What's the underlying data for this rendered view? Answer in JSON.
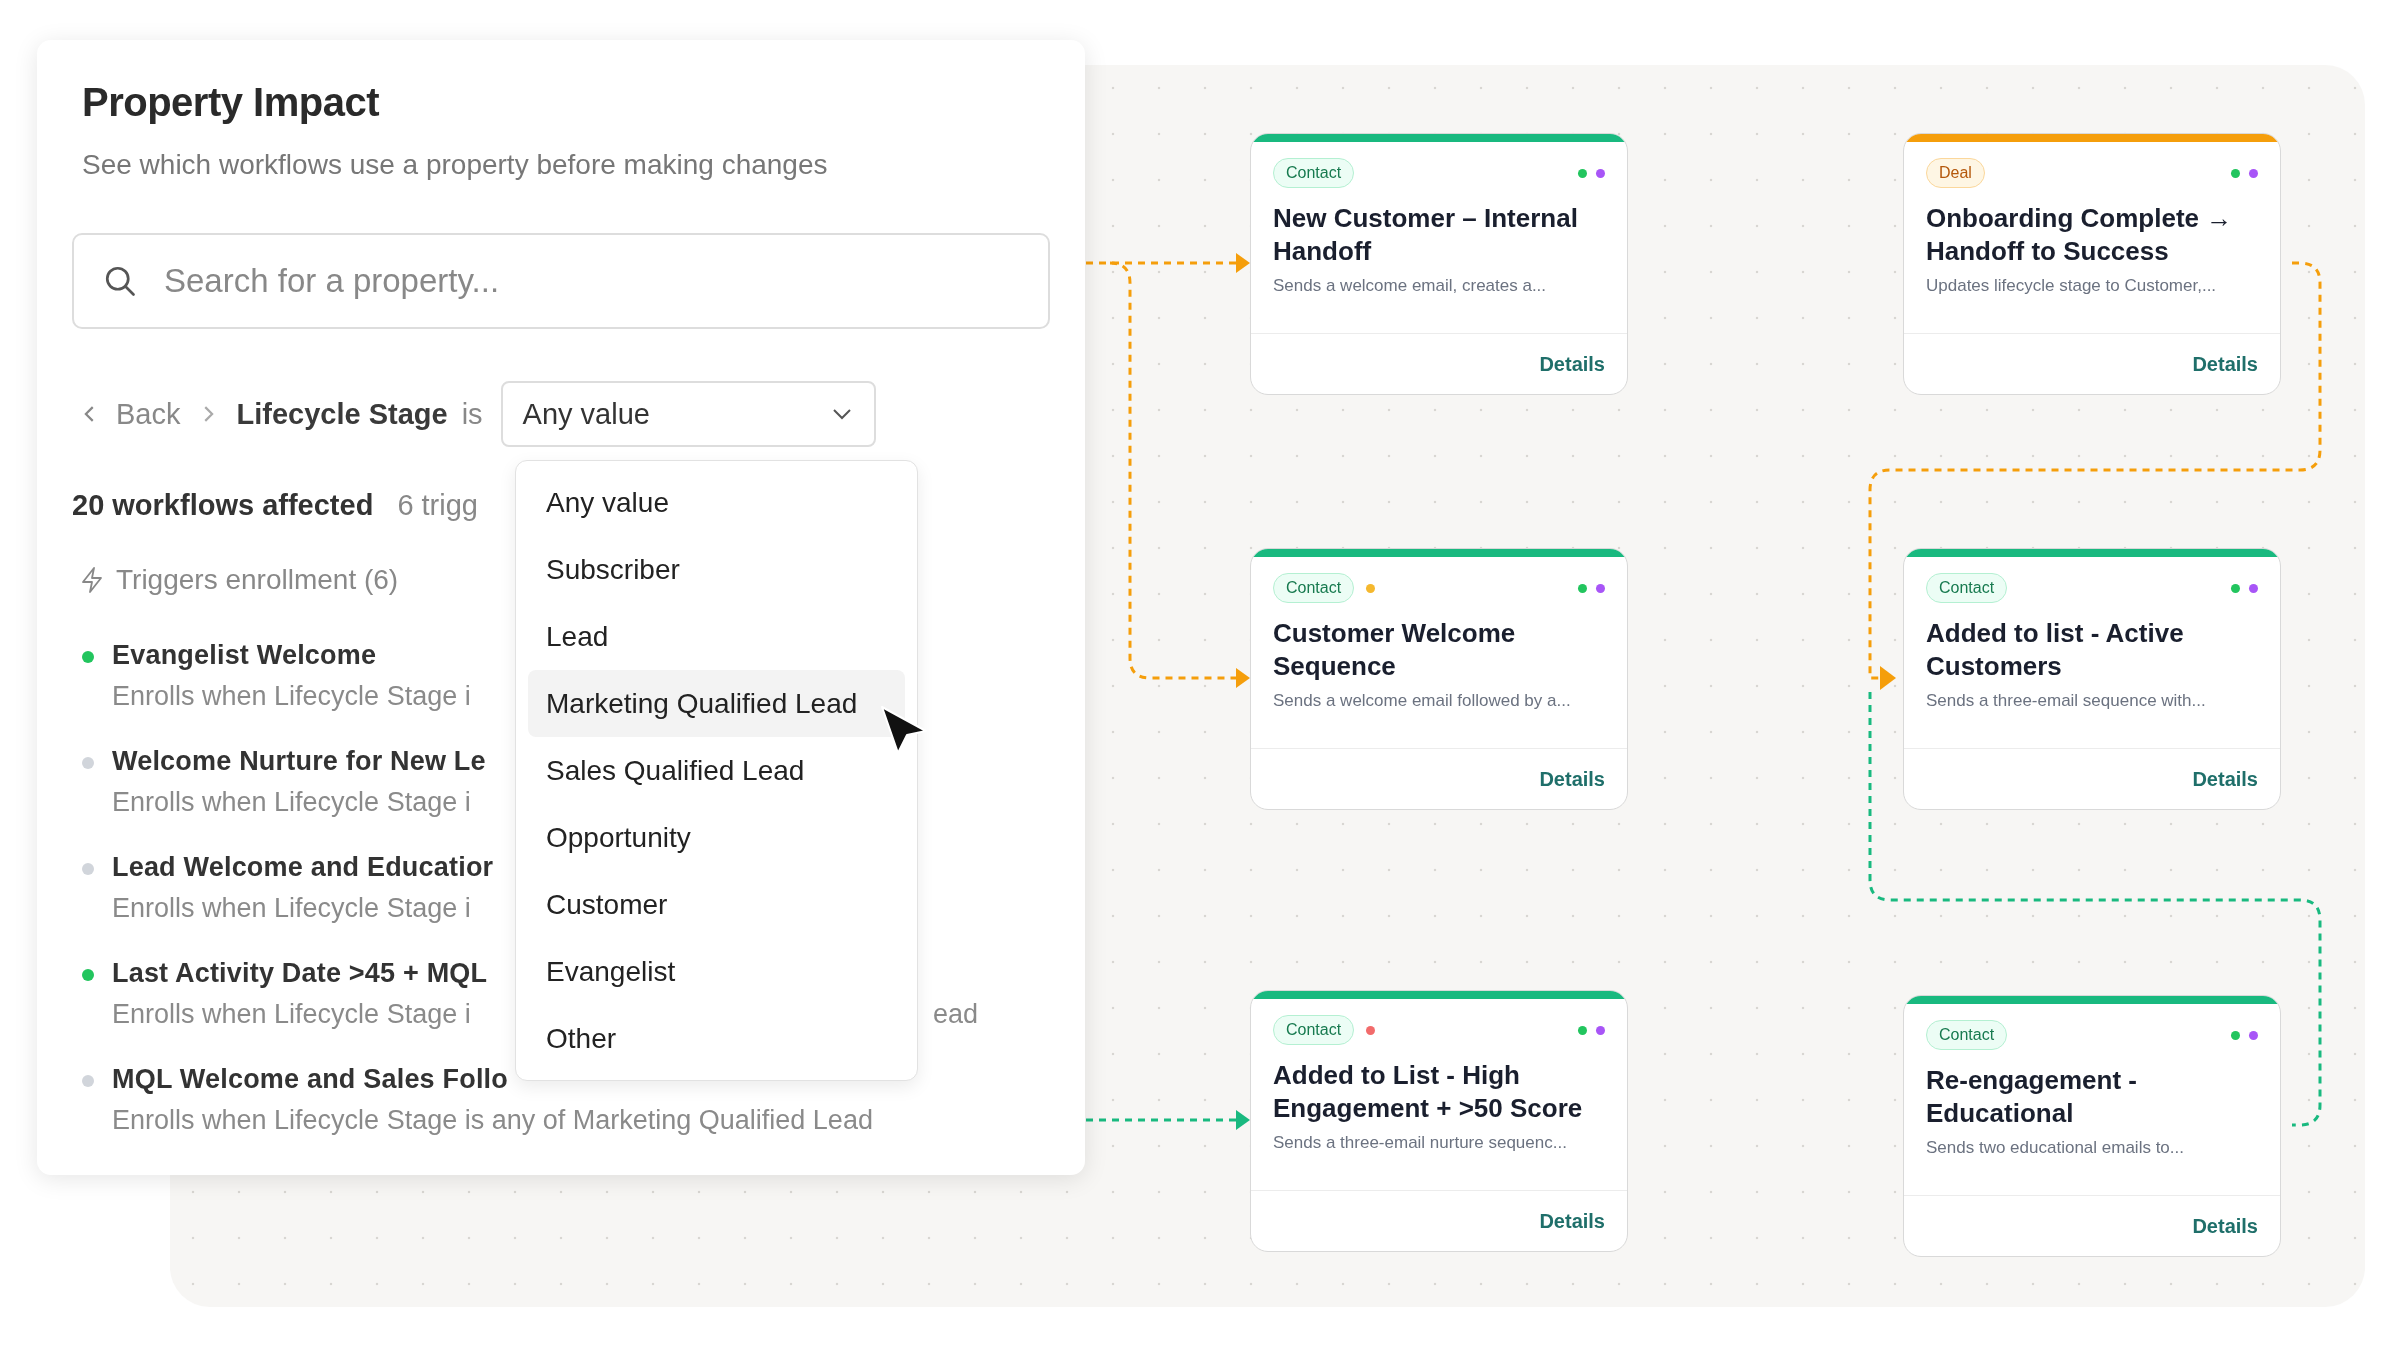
{
  "panel": {
    "title": "Property Impact",
    "subtitle": "See which workflows use a property before making changes",
    "search": {
      "placeholder": "Search for a property..."
    },
    "breadcrumb": {
      "back": "Back",
      "property": "Lifecycle Stage",
      "operator": "is",
      "value": "Any value"
    },
    "summary": {
      "affected": "20 workflows affected",
      "triggers": "6 trigg"
    },
    "section": {
      "label": "Triggers enrollment (6)"
    },
    "workflows": [
      {
        "name": "Evangelist Welcome",
        "description": "Enrolls when Lifecycle Stage i",
        "color": "#22c55e"
      },
      {
        "name": "Welcome Nurture for New Le",
        "description": "Enrolls when Lifecycle Stage i",
        "color": "#d1d5db"
      },
      {
        "name": "Lead Welcome and Educatior",
        "description": "Enrolls when Lifecycle Stage i",
        "color": "#d1d5db"
      },
      {
        "name": "Last Activity Date >45 + MQL",
        "description": "Enrolls when Lifecycle Stage i",
        "tail": "ead",
        "color": "#22c55e"
      },
      {
        "name": "MQL Welcome and Sales Follo",
        "description": "Enrolls when Lifecycle Stage is any of Marketing Qualified Lead",
        "color": "#d1d5db"
      }
    ],
    "dropdown": {
      "options": [
        {
          "label": "Any value",
          "highlighted": false
        },
        {
          "label": "Subscriber",
          "highlighted": false
        },
        {
          "label": "Lead",
          "highlighted": false
        },
        {
          "label": "Marketing Qualified Lead",
          "highlighted": true
        },
        {
          "label": "Sales Qualified Lead",
          "highlighted": false
        },
        {
          "label": "Opportunity",
          "highlighted": false
        },
        {
          "label": "Customer",
          "highlighted": false
        },
        {
          "label": "Evangelist",
          "highlighted": false
        },
        {
          "label": "Other",
          "highlighted": false
        }
      ]
    }
  },
  "cards": [
    {
      "kind": "contact",
      "badge": "Contact",
      "title": "New Customer – Internal Handoff",
      "description": "Sends a welcome email, creates a...",
      "link": "Details",
      "status_dots": [
        {
          "color": "#22c55e"
        },
        {
          "color": "#a855f7"
        }
      ]
    },
    {
      "kind": "deal",
      "badge": "Deal",
      "title": "Onboarding Complete → Handoff to Success",
      "description": "Updates lifecycle stage to Customer,...",
      "link": "Details",
      "status_dots": [
        {
          "color": "#22c55e"
        },
        {
          "color": "#a855f7"
        }
      ]
    },
    {
      "kind": "contact",
      "badge": "Contact",
      "flag": {
        "color": "#f5b82e"
      },
      "title": "Customer Welcome Sequence",
      "description": "Sends a welcome email followed by a...",
      "link": "Details",
      "status_dots": [
        {
          "color": "#22c55e"
        },
        {
          "color": "#a855f7"
        }
      ]
    },
    {
      "kind": "contact",
      "badge": "Contact",
      "title": "Added to list - Active Customers",
      "description": "Sends a three-email sequence with...",
      "link": "Details",
      "status_dots": [
        {
          "color": "#22c55e"
        },
        {
          "color": "#a855f7"
        }
      ]
    },
    {
      "kind": "contact",
      "badge": "Contact",
      "flag": {
        "color": "#f26b6b"
      },
      "title": "Added to List - High Engagement + >50 Score",
      "description": "Sends a three-email nurture sequenc...",
      "link": "Details",
      "status_dots": [
        {
          "color": "#22c55e"
        },
        {
          "color": "#a855f7"
        }
      ]
    },
    {
      "kind": "contact",
      "badge": "Contact",
      "title": "Re-engagement - Educational",
      "description": "Sends two educational emails to...",
      "link": "Details",
      "status_dots": [
        {
          "color": "#22c55e"
        },
        {
          "color": "#a855f7"
        }
      ]
    }
  ]
}
